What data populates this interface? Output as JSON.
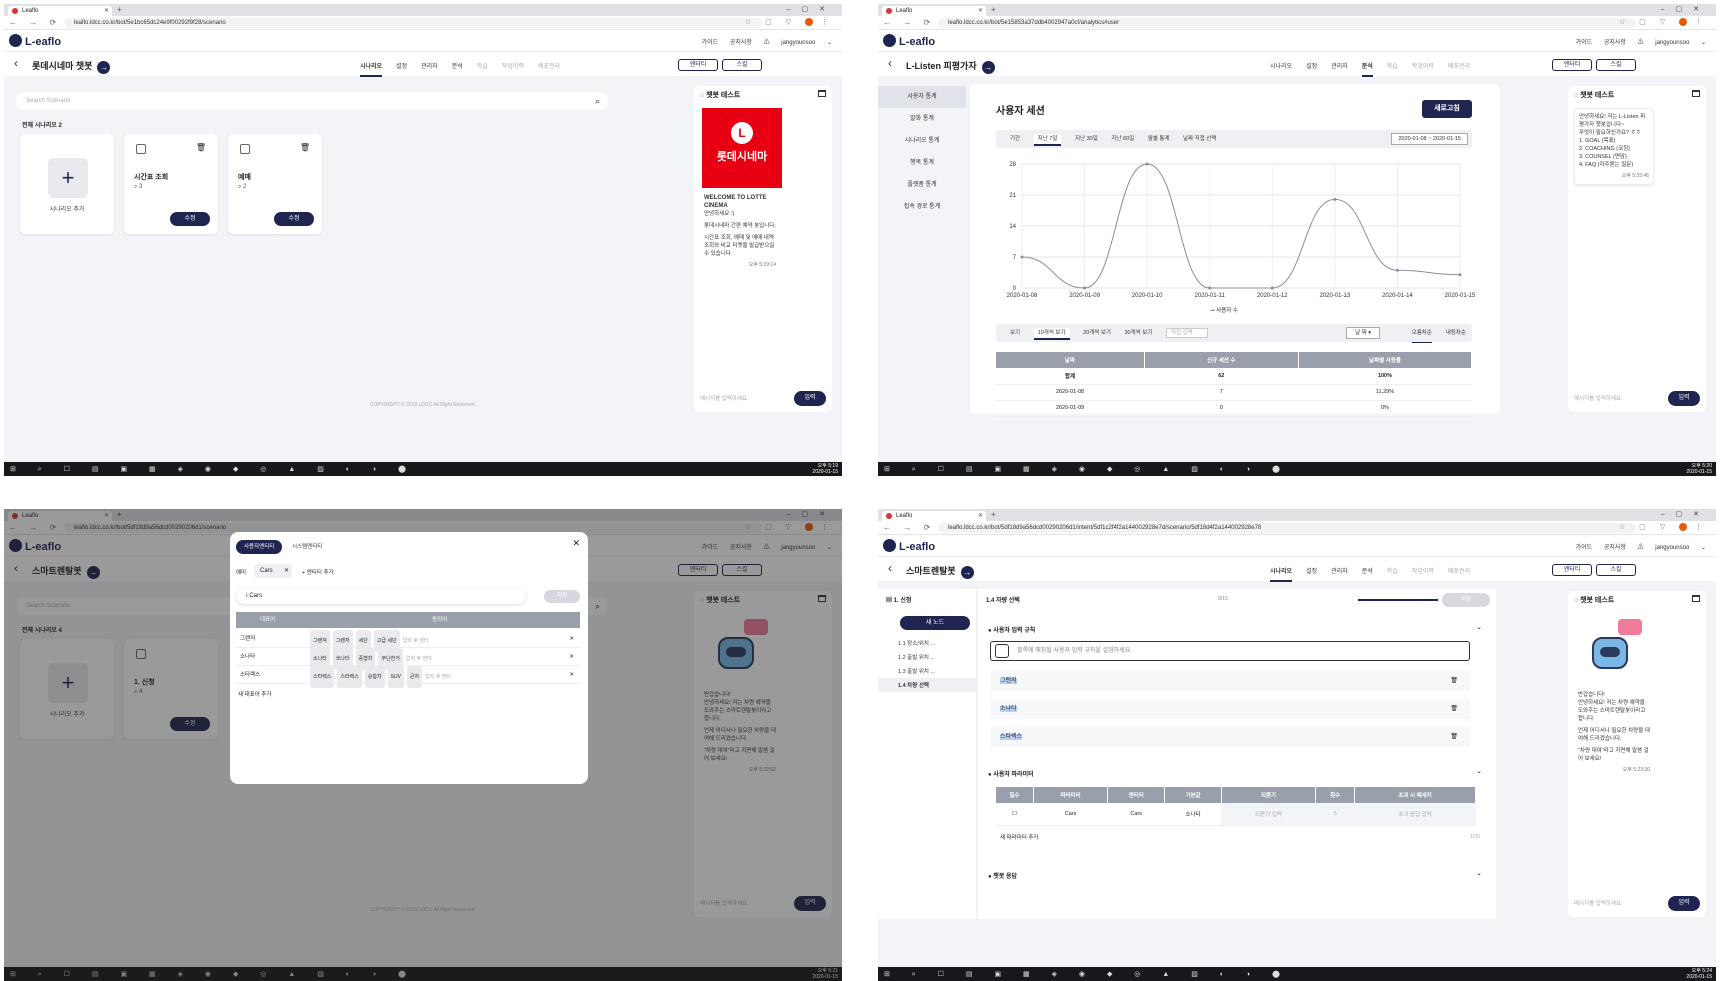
{
  "shared": {
    "tab_title": "Leaflo",
    "new_tab": "+",
    "nav_buttons": "← → ⟳ ⌂",
    "logo_text": "L-eaflo",
    "header_links": "가이드 공지사항 ⚠ jangyounsoo ⌄",
    "main_tabs": [
      "시나리오",
      "설정",
      "관리자",
      "분석",
      "학습",
      "작업이력",
      "배포관리"
    ],
    "btn_entity": "엔터티",
    "btn_skill": "스킬",
    "chat_title": "챗봇 테스트",
    "chat_placeholder": "메시지를 입력하세요.",
    "chat_send": "입력",
    "taskbar_icons": "⊞ ⌕ ☐ ▤ ▣ ▦ ◈ ◉ ◆ ◎ ▲ ▨ ◐ ◑ ⬤",
    "copyright": "COPYRIGHT © 2019 LDCC All Right Reserved.",
    "colors": {
      "navy": "#1f2550",
      "accent_red": "#e60012"
    }
  },
  "q1": {
    "url": "leaflo.ldcc.co.kr/bot/5e1bc65dc24e9f00292f9f28/scenario",
    "bot_name": "롯데시네마 챗봇",
    "search_placeholder": "Search Scenario",
    "scenario_count": "전체 시나리오 2",
    "add_label": "시나리오 추가",
    "cards": [
      {
        "title": "시간표 조회",
        "count": "3",
        "btn": "수정"
      },
      {
        "title": "예매",
        "count": "2",
        "btn": "수정"
      }
    ],
    "chat_banner": "롯데시네마",
    "chat_lines": [
      "WELCOME TO LOTTE CINEMA",
      "안녕하세요 :)",
      "롯데시네마 간편 예약 봇입니다.",
      "시간표 조회, 예매 및 예매 내역 조회와 비교 티켓을 발급받으실 수 있습니다."
    ],
    "chat_time": "오후 5:19:14",
    "clock": "오후 5:19\n2020-01-15"
  },
  "q2": {
    "url": "leaflo.ldcc.co.kr/bot/5e15853a37ddb4002947a0cf/analytics#user",
    "bot_name": "L-Listen 피평가자",
    "side_items": [
      "사용자 통계",
      "발화 통계",
      "시나리오 통계",
      "행복 통계",
      "플랫폼 통계",
      "접속 경로 통계"
    ],
    "title": "사용자 세션",
    "refresh": "새로고침",
    "period_label": "기간",
    "period_opts": [
      "지난 7일",
      "지난 30일",
      "지난 60일",
      "월별 통계",
      "날짜 직접 선택"
    ],
    "date_range": "2020-01-08  ~  2020-01-15",
    "legend": "사용자 수",
    "view_label": "보기",
    "view_opts": [
      "10개씩 보기",
      "20개씩 보기",
      "30개씩 보기"
    ],
    "direct_input": "직접 입력",
    "sort_by": "날 짜 ▾",
    "sort_opts": [
      "오름차순",
      "내림차순"
    ],
    "table_headers": [
      "날짜",
      "신규 세션 수",
      "날짜별 사용률"
    ],
    "table_rows": [
      [
        "합계",
        "62",
        "100%"
      ],
      [
        "2020-01-08",
        "7",
        "11.29%"
      ],
      [
        "2020-01-09",
        "0",
        "0%"
      ]
    ],
    "chat_lines": [
      "안녕하세요! 저는 L-Listen 피평가자 챗봇입니다~",
      "무엇이 필요하신가요? ㅎㅎ",
      "1. GOAL (목표)",
      "2. COACHING (코칭)",
      "3. COUNSEL (면담)",
      "4. FAQ (자주묻는 질문)"
    ],
    "chat_time": "오후 5:33:46",
    "clock": "오후 5:20\n2020-01-15"
  },
  "chart_data": {
    "type": "line",
    "x": [
      "2020-01-08",
      "2020-01-09",
      "2020-01-10",
      "2020-01-11",
      "2020-01-12",
      "2020-01-13",
      "2020-01-14",
      "2020-01-15"
    ],
    "series": [
      {
        "name": "사용자 수",
        "values": [
          7,
          0,
          28,
          0,
          0,
          20,
          4,
          3
        ]
      }
    ],
    "yticks": [
      0,
      7,
      14,
      21,
      28
    ],
    "ylim": [
      0,
      28
    ]
  },
  "q3": {
    "url": "leaflo.ldcc.co.kr/bot/5df18d9a56dcd00290206d1/scenario",
    "bot_name": "스마트렌탈봇",
    "modal_tabs": [
      "사용자엔티티",
      "시스템엔티티"
    ],
    "entity_label": "예미",
    "entity_name": "Cars",
    "add_entity": "+ 엔티티 추가",
    "entity_input": "Cars",
    "save": "저장",
    "col_rep": "대표어",
    "col_syn": "동의어",
    "rows": [
      {
        "rep": "그랜저",
        "syns": [
          "그랜져",
          "그랜저",
          "세단",
          "고급 세단"
        ]
      },
      {
        "rep": "소나타",
        "syns": [
          "소나타",
          "쏘나타",
          "중형차",
          "무난한거"
        ]
      },
      {
        "rep": "스타렉스",
        "syns": [
          "스타렉스",
          "스타렉스",
          "승합차",
          "SUV",
          "큰차"
        ]
      }
    ],
    "syn_placeholder": "입력 후 엔터",
    "add_rep": "새 대표어 추가",
    "scenario_count": "전체 시나리오 4",
    "card_title": "1. 신청",
    "card_count": "4",
    "chat_lines": [
      "반갑습니다!",
      "안녕하세요! 저는 차량 예약을 도와주는 스마트렌탈봇이라고 합니다.",
      "언제 어디서나 필요한 차량을 대여해 드리겠습니다.",
      "\"차량 대여\"라고 지면해 말씀 걸어 보세요!"
    ],
    "chat_time": "오후 5:22:52",
    "clock": "오후 5:21\n2020-01-15"
  },
  "q4": {
    "url": "leaflo.ldcc.co.kr/bot/5df18d9a56dcd00290206d1/intent/5df1c2f4f2a144002928e7d/scenario/5df18d4f2a144002928e78",
    "bot_name": "스마트렌탈봇",
    "scenario_name": "1. 신청",
    "new_node": "새 노드",
    "nodes": [
      "1.1 장소/위치 ...",
      "1.2 출발 위치 ...",
      "1.3 출발 위치 ...",
      "1.4 차량 선택"
    ],
    "node_title": "1.4 차량 선택",
    "node_count": "9/15",
    "save": "저장",
    "sec_input": "사용자 입력 규칙",
    "input_ph": "블록에 매칭될 사용자 입력 규칙을 설정하세요.",
    "entities": [
      "그랜저",
      "소나타",
      "스타렉스"
    ],
    "sec_params": "사용자 파라미터",
    "param_headers": [
      "필수",
      "파라미터",
      "엔티티",
      "기본값",
      "되묻기",
      "횟수",
      "초과 시 메세지"
    ],
    "param_row": [
      "☐",
      "Cars",
      "Cars",
      "소나타",
      "되묻기 입력",
      "5",
      "초과 응답 입력"
    ],
    "add_param": "새 파라미터 추가",
    "param_count": "1/20",
    "sec_resp": "챗봇 응답",
    "chat_time": "오후 5:23:30",
    "clock": "오후 5:24\n2020-01-15"
  }
}
